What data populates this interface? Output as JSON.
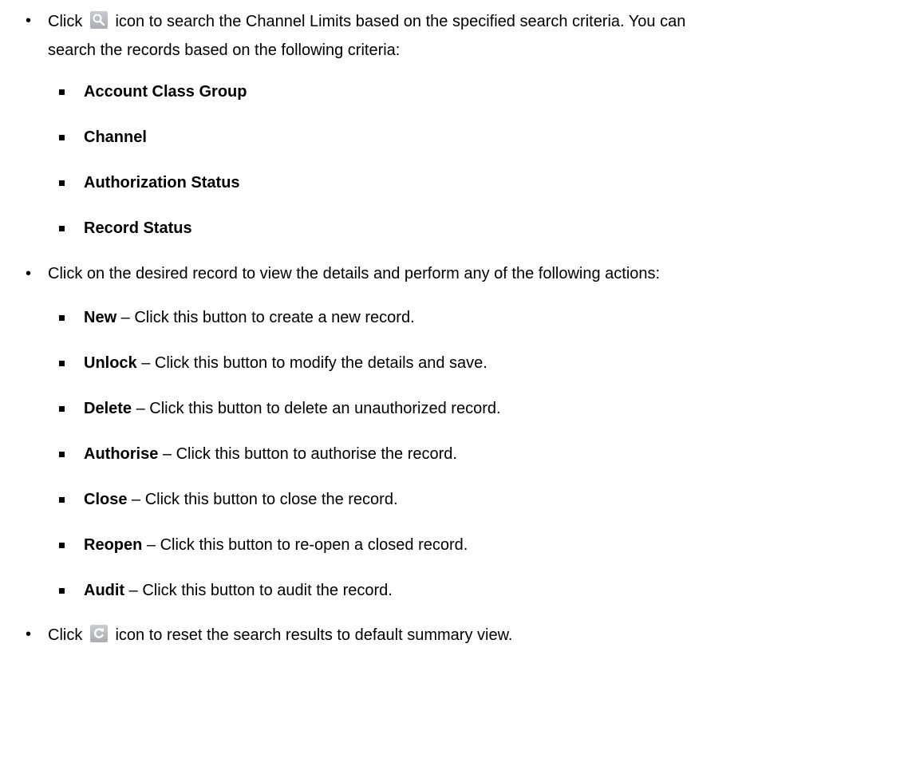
{
  "bullets": {
    "search": {
      "prefix": "Click",
      "icon": "search-icon",
      "line1": "icon to search the Channel Limits based on the specified search criteria. You can",
      "line2": "search the records based on the following criteria:"
    },
    "criteria": [
      "Account Class Group",
      "Channel",
      "Authorization Status",
      "Record Status"
    ],
    "actions_intro": "Click on the desired record to view the details and perform any of the following actions:",
    "actions": [
      {
        "name": "New",
        "desc": " – Click this button to create a new record."
      },
      {
        "name": "Unlock",
        "desc": " – Click this button to modify the details and save."
      },
      {
        "name": "Delete",
        "desc": " – Click this button to delete an unauthorized record."
      },
      {
        "name": "Authorise",
        "desc": " – Click this button to authorise the record."
      },
      {
        "name": "Close",
        "desc": " – Click this button to close the record."
      },
      {
        "name": "Reopen",
        "desc": " – Click this button to re-open a closed record."
      },
      {
        "name": "Audit",
        "desc": " – Click this button to audit the record."
      }
    ],
    "reset": {
      "prefix": "Click",
      "icon": "refresh-icon",
      "text": "icon to reset the search results to default summary view."
    }
  }
}
